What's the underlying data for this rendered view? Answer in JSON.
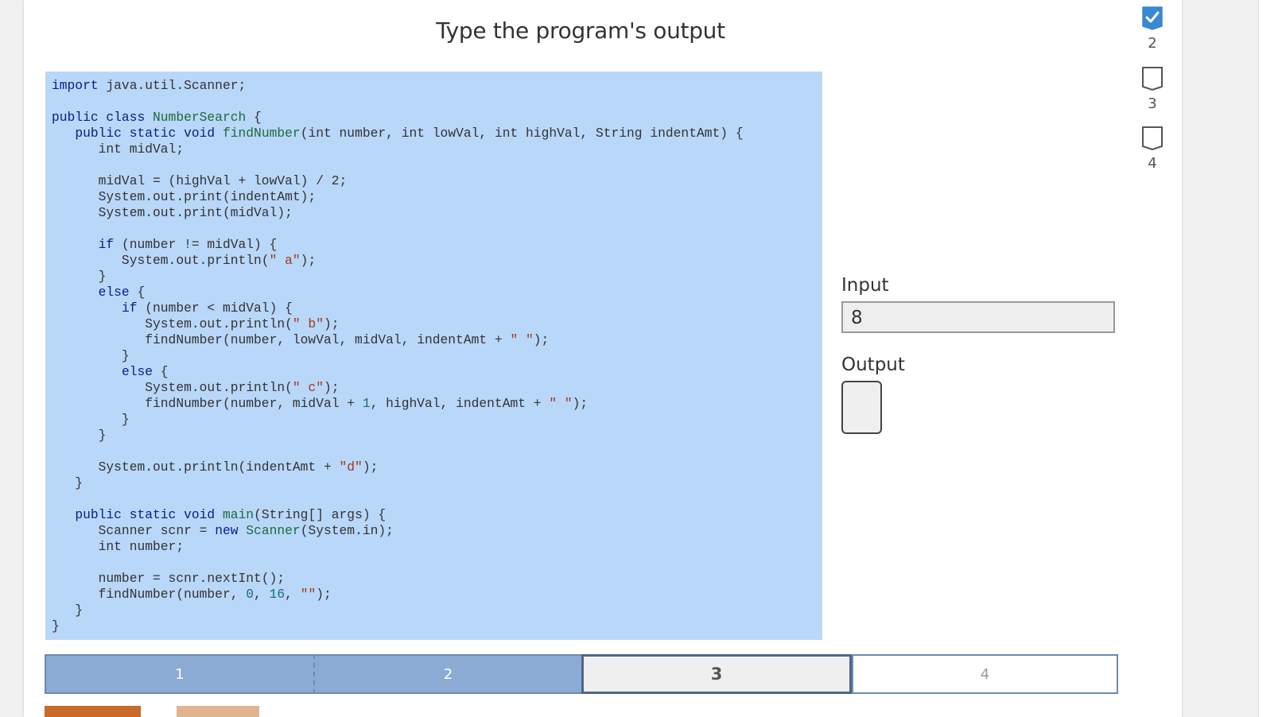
{
  "title": "Type the program's output",
  "code_lines": [
    [
      {
        "t": "import",
        "c": "kw"
      },
      {
        "t": " java.util.Scanner;"
      }
    ],
    [],
    [
      {
        "t": "public class",
        "c": "kw"
      },
      {
        "t": " "
      },
      {
        "t": "NumberSearch",
        "c": "cls"
      },
      {
        "t": " {"
      }
    ],
    [
      {
        "t": "   "
      },
      {
        "t": "public static void",
        "c": "kw"
      },
      {
        "t": " "
      },
      {
        "t": "findNumber",
        "c": "cls"
      },
      {
        "t": "(int number, int lowVal, int highVal, String indentAmt) {"
      }
    ],
    [
      {
        "t": "      int midVal;"
      }
    ],
    [],
    [
      {
        "t": "      midVal = (highVal + lowVal) / 2;"
      }
    ],
    [
      {
        "t": "      System.out.print(indentAmt);"
      }
    ],
    [
      {
        "t": "      System.out.print(midVal);"
      }
    ],
    [],
    [
      {
        "t": "      "
      },
      {
        "t": "if",
        "c": "kw"
      },
      {
        "t": " (number != midVal) {"
      }
    ],
    [
      {
        "t": "         System.out.println("
      },
      {
        "t": "\" a\"",
        "c": "str"
      },
      {
        "t": ");"
      }
    ],
    [
      {
        "t": "      }"
      }
    ],
    [
      {
        "t": "      "
      },
      {
        "t": "else",
        "c": "kw"
      },
      {
        "t": " {"
      }
    ],
    [
      {
        "t": "         "
      },
      {
        "t": "if",
        "c": "kw"
      },
      {
        "t": " (number < midVal) {"
      }
    ],
    [
      {
        "t": "            System.out.println("
      },
      {
        "t": "\" b\"",
        "c": "str"
      },
      {
        "t": ");"
      }
    ],
    [
      {
        "t": "            findNumber(number, lowVal, midVal, indentAmt + "
      },
      {
        "t": "\" \"",
        "c": "str"
      },
      {
        "t": ");"
      }
    ],
    [
      {
        "t": "         }"
      }
    ],
    [
      {
        "t": "         "
      },
      {
        "t": "else",
        "c": "kw"
      },
      {
        "t": " {"
      }
    ],
    [
      {
        "t": "            System.out.println("
      },
      {
        "t": "\" c\"",
        "c": "str"
      },
      {
        "t": ");"
      }
    ],
    [
      {
        "t": "            findNumber(number, midVal + "
      },
      {
        "t": "1",
        "c": "num"
      },
      {
        "t": ", highVal, indentAmt + "
      },
      {
        "t": "\" \"",
        "c": "str"
      },
      {
        "t": ");"
      }
    ],
    [
      {
        "t": "         }"
      }
    ],
    [
      {
        "t": "      }"
      }
    ],
    [],
    [
      {
        "t": "      System.out.println(indentAmt + "
      },
      {
        "t": "\"d\"",
        "c": "str"
      },
      {
        "t": ");"
      }
    ],
    [
      {
        "t": "   }"
      }
    ],
    [],
    [
      {
        "t": "   "
      },
      {
        "t": "public static void",
        "c": "kw"
      },
      {
        "t": " "
      },
      {
        "t": "main",
        "c": "cls"
      },
      {
        "t": "(String[] args) {"
      }
    ],
    [
      {
        "t": "      Scanner scnr = "
      },
      {
        "t": "new",
        "c": "kw"
      },
      {
        "t": " "
      },
      {
        "t": "Scanner",
        "c": "cls"
      },
      {
        "t": "(System.in);"
      }
    ],
    [
      {
        "t": "      int number;"
      }
    ],
    [],
    [
      {
        "t": "      number = scnr.nextInt();"
      }
    ],
    [
      {
        "t": "      findNumber(number, "
      },
      {
        "t": "0",
        "c": "num"
      },
      {
        "t": ", "
      },
      {
        "t": "16",
        "c": "num"
      },
      {
        "t": ", "
      },
      {
        "t": "\"\"",
        "c": "str"
      },
      {
        "t": ");"
      }
    ],
    [
      {
        "t": "   }"
      }
    ],
    [
      {
        "t": "}"
      }
    ]
  ],
  "input": {
    "label": "Input",
    "value": "8"
  },
  "output": {
    "label": "Output",
    "value": ""
  },
  "progress": [
    {
      "label": "1",
      "state": "done"
    },
    {
      "label": "2",
      "state": "done"
    },
    {
      "label": "3",
      "state": "current"
    },
    {
      "label": "4",
      "state": "todo"
    }
  ],
  "levels": [
    {
      "label": "2",
      "checked": true
    },
    {
      "label": "3",
      "checked": false
    },
    {
      "label": "4",
      "checked": false
    }
  ],
  "colors": {
    "check_blue": "#3a87d2",
    "check_button": "#c86a2a",
    "next_button": "#e1b48f"
  }
}
